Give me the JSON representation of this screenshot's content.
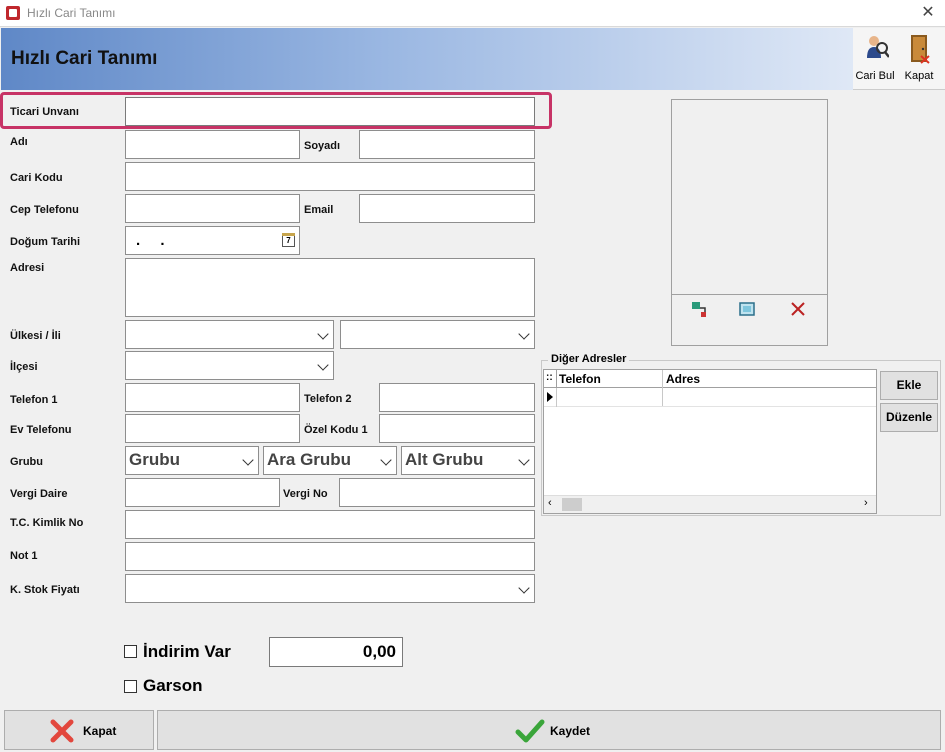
{
  "window": {
    "title": "Hızlı Cari Tanımı",
    "close_glyph": "✕"
  },
  "header": {
    "title": "Hızlı Cari Tanımı"
  },
  "toolbar": {
    "cari_bul_label": "Cari Bul",
    "kapat_label": "Kapat"
  },
  "form": {
    "ticari_unvan_label": "Ticari Unvanı",
    "adi_label": "Adı",
    "soyadi_label": "Soyadı",
    "cari_kodu_label": "Cari Kodu",
    "cep_telefonu_label": "Cep Telefonu",
    "email_label": "Email",
    "dogum_tarihi_label": "Doğum Tarihi",
    "dogum_tarihi_value": ". .",
    "adresi_label": "Adresi",
    "ulke_il_label": "Ülkesi / İli",
    "ilce_label": "İlçesi",
    "telefon1_label": "Telefon 1",
    "telefon2_label": "Telefon 2",
    "ev_telefonu_label": "Ev Telefonu",
    "ozel_kodu1_label": "Özel Kodu 1",
    "grubu_label": "Grubu",
    "grubu_value": "Grubu",
    "ara_grubu_value": "Ara Grubu",
    "alt_grubu_value": "Alt Grubu",
    "vergi_daire_label": "Vergi Daire",
    "vergi_no_label": "Vergi No",
    "tc_kimlik_label": "T.C. Kimlik No",
    "not1_label": "Not 1",
    "stok_fiyati_label": "K. Stok Fiyatı"
  },
  "calendar_icon_text": "7",
  "addresses": {
    "title": "Diğer Adresler",
    "columns": [
      "Telefon",
      "Adres"
    ],
    "grid_corner": "::",
    "add_button": "Ekle",
    "edit_button": "Düzenle"
  },
  "options": {
    "indirim_label": "İndirim Var",
    "indirim_value": "0,00",
    "garson_label": "Garson"
  },
  "footer": {
    "kapat_label": "Kapat",
    "kaydet_label": "Kaydet"
  },
  "icons": {
    "photo_load": "photo-load-icon",
    "photo_view": "photo-view-icon",
    "photo_delete": "photo-delete-icon"
  },
  "colors": {
    "highlight": "#c73366",
    "header_start": "#5f88c7",
    "header_end": "#dfe8f6"
  }
}
